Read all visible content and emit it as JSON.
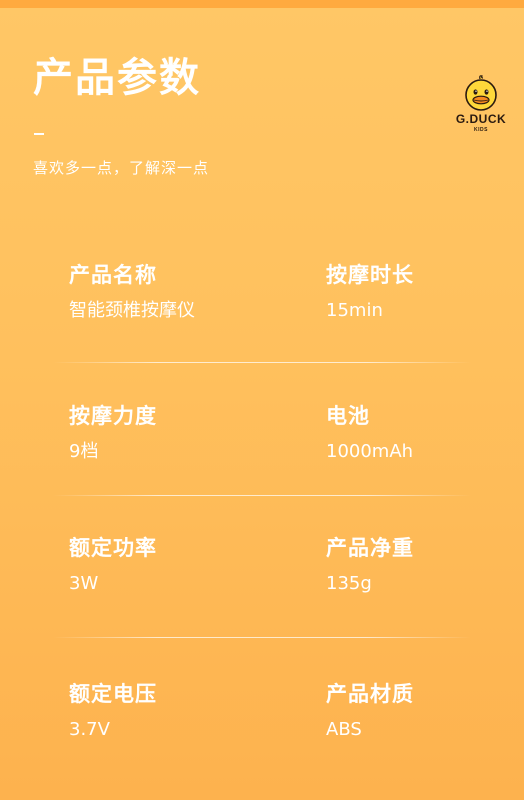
{
  "header": {
    "title": "产品参数",
    "subtitle": "喜欢多一点，了解深一点"
  },
  "brand": {
    "logo_text": "G.DUCK",
    "logo_sub": "KIDS",
    "logo_icon": "duck-head-icon"
  },
  "specs": [
    {
      "label": "产品名称",
      "value": "智能颈椎按摩仪"
    },
    {
      "label": "按摩时长",
      "value": "15min"
    },
    {
      "label": "按摩力度",
      "value": "9档"
    },
    {
      "label": "电池",
      "value": "1000mAh"
    },
    {
      "label": "额定功率",
      "value": "3W"
    },
    {
      "label": "产品净重",
      "value": "135g"
    },
    {
      "label": "额定电压",
      "value": "3.7V"
    },
    {
      "label": "产品材质",
      "value": "ABS"
    }
  ],
  "colors": {
    "background_top": "#FFC766",
    "background_bottom": "#FDB24E",
    "text": "#FFFFFF"
  }
}
